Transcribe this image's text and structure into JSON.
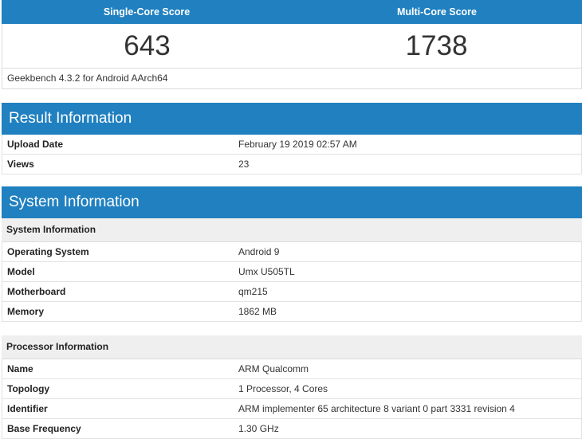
{
  "scores": {
    "single_label": "Single-Core Score",
    "multi_label": "Multi-Core Score",
    "single_value": "643",
    "multi_value": "1738",
    "version": "Geekbench 4.3.2 for Android AArch64"
  },
  "result": {
    "title": "Result Information",
    "rows": [
      {
        "label": "Upload Date",
        "value": "February 19 2019 02:57 AM"
      },
      {
        "label": "Views",
        "value": "23"
      }
    ]
  },
  "system": {
    "title": "System Information",
    "sub1": "System Information",
    "rows1": [
      {
        "label": "Operating System",
        "value": "Android 9"
      },
      {
        "label": "Model",
        "value": "Umx U505TL"
      },
      {
        "label": "Motherboard",
        "value": "qm215"
      },
      {
        "label": "Memory",
        "value": "1862 MB"
      }
    ],
    "sub2": "Processor Information",
    "rows2": [
      {
        "label": "Name",
        "value": "ARM Qualcomm"
      },
      {
        "label": "Topology",
        "value": "1 Processor, 4 Cores"
      },
      {
        "label": "Identifier",
        "value": "ARM implementer 65 architecture 8 variant 0 part 3331 revision 4"
      },
      {
        "label": "Base Frequency",
        "value": "1.30 GHz"
      }
    ]
  },
  "colors": {
    "accent": "#2080c0",
    "subhead_bg": "#efefef"
  }
}
